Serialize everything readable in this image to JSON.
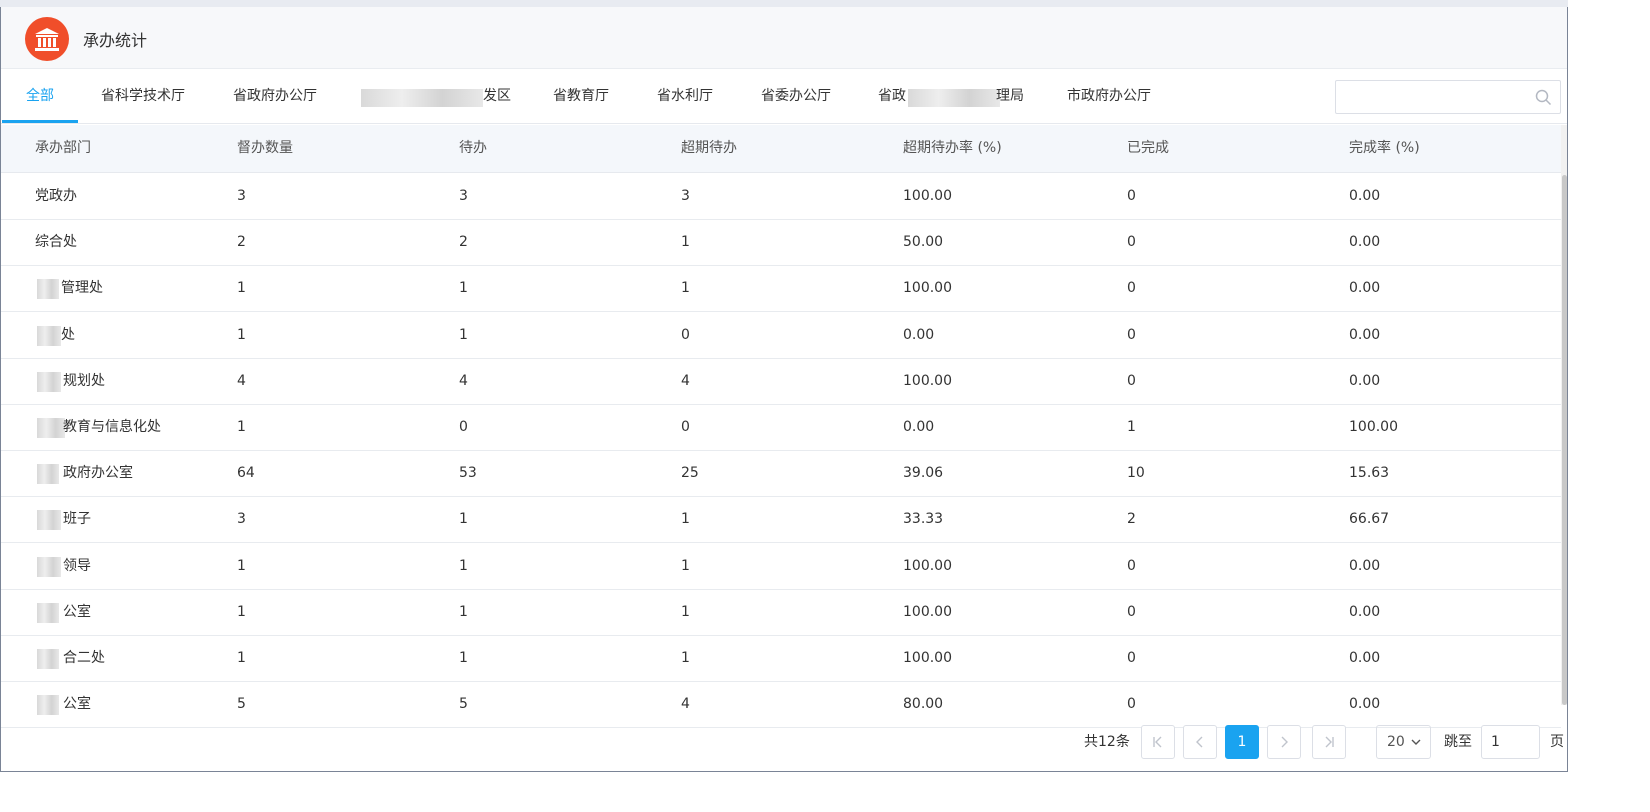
{
  "header": {
    "title": "承办统计"
  },
  "tabs": [
    {
      "label": "全部",
      "active": true
    },
    {
      "label": "省科学技术厅"
    },
    {
      "label": "省政府办公厅"
    },
    {
      "label": "发区"
    },
    {
      "label": "省教育厅"
    },
    {
      "label": "省水利厅"
    },
    {
      "label": "省委办公厅"
    },
    {
      "label": "省政"
    },
    {
      "label": "理局"
    },
    {
      "label": "市政府办公厅"
    }
  ],
  "search": {
    "placeholder": "",
    "value": ""
  },
  "table": {
    "columns": [
      "承办部门",
      "督办数量",
      "待办",
      "超期待办",
      "超期待办率 (%)",
      "已完成",
      "完成率 (%)"
    ],
    "rows": [
      [
        "党政办",
        "3",
        "3",
        "3",
        "100.00",
        "0",
        "0.00"
      ],
      [
        "综合处",
        "2",
        "2",
        "1",
        "50.00",
        "0",
        "0.00"
      ],
      [
        "管理处",
        "1",
        "1",
        "1",
        "100.00",
        "0",
        "0.00"
      ],
      [
        "处",
        "1",
        "1",
        "0",
        "0.00",
        "0",
        "0.00"
      ],
      [
        "规划处",
        "4",
        "4",
        "4",
        "100.00",
        "0",
        "0.00"
      ],
      [
        "教育与信息化处",
        "1",
        "0",
        "0",
        "0.00",
        "1",
        "100.00"
      ],
      [
        "政府办公室",
        "64",
        "53",
        "25",
        "39.06",
        "10",
        "15.63"
      ],
      [
        "班子",
        "3",
        "1",
        "1",
        "33.33",
        "2",
        "66.67"
      ],
      [
        "领导",
        "1",
        "1",
        "1",
        "100.00",
        "0",
        "0.00"
      ],
      [
        "公室",
        "1",
        "1",
        "1",
        "100.00",
        "0",
        "0.00"
      ],
      [
        "合二处",
        "1",
        "1",
        "1",
        "100.00",
        "0",
        "0.00"
      ],
      [
        "公室",
        "5",
        "5",
        "4",
        "80.00",
        "0",
        "0.00"
      ]
    ]
  },
  "pagination": {
    "total": "共12条",
    "current_page": "1",
    "page_size": "20",
    "jump_label": "跳至",
    "jump_value": "1",
    "page_unit": "页"
  },
  "colors": {
    "accent": "#1aa3f0",
    "logo": "#f04e2a"
  },
  "icons": {
    "logo": "bank-icon",
    "search": "search-icon",
    "first": "first-page-icon",
    "prev": "prev-page-icon",
    "next": "next-page-icon",
    "last": "last-page-icon",
    "dropdown": "chevron-down-icon"
  }
}
